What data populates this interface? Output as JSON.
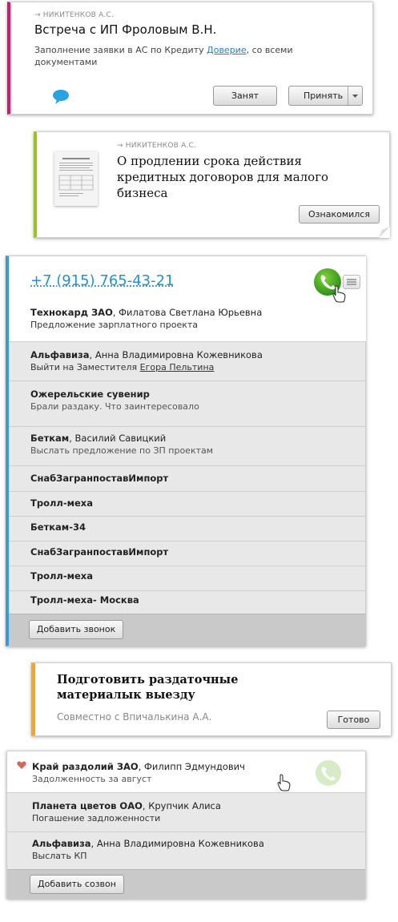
{
  "card1": {
    "from": "→ НИКИТЕНКОВ А.С.",
    "title": "Встреча с ИП Фроловым В.Н.",
    "desc_before": "Заполнение заявки в АС по Кредиту ",
    "desc_link": "Доверие",
    "desc_after": ", со всеми документами",
    "btn_busy": "Занят",
    "btn_accept": "Принять",
    "accent": "#d8166b"
  },
  "card2": {
    "from": "→ НИКИТЕНКОВ А.С.",
    "title_lines": [
      "О продлении срока действия",
      "кредитных договоров для малого",
      "бизнеса"
    ],
    "btn": "Ознакомился",
    "accent": "#9bc31d"
  },
  "card3": {
    "phone": "+7 (915) 765-43-21",
    "accent": "#3a9ad9",
    "active": {
      "company": "Технокард ЗАО",
      "person": ", Филатова Светлана Юрьевна",
      "note": "Предложение зарплатного проекта"
    },
    "rows": [
      {
        "company": "Альфавиза",
        "person": ", Анна Владимировна Кожевникова",
        "note_before": "Выйти на Заместителя ",
        "note_link": "Егора Пельтина"
      },
      {
        "company": "Ожерельские сувенир",
        "person": "",
        "note_before": "Брали раздаку. Что заинтересовало",
        "note_link": ""
      },
      {
        "company": "Беткам",
        "person": ", Василий Савицкий",
        "note_before": "Выслать предложение по ЗП проектам",
        "note_link": ""
      },
      {
        "company": "СнабЗагранпоставИмпорт",
        "person": "",
        "note_before": "",
        "note_link": ""
      },
      {
        "company": "Тролл-меха",
        "person": "",
        "note_before": "",
        "note_link": ""
      },
      {
        "company": "Беткам-34",
        "person": "",
        "note_before": "",
        "note_link": ""
      },
      {
        "company": "СнабЗагранпоставИмпорт",
        "person": "",
        "note_before": "",
        "note_link": ""
      },
      {
        "company": "Тролл-меха",
        "person": "",
        "note_before": "",
        "note_link": ""
      },
      {
        "company": "Тролл-меха- Москва",
        "person": "",
        "note_before": "",
        "note_link": ""
      }
    ],
    "btn": "Добавить звонок"
  },
  "card4": {
    "title_lines": [
      "Подготовить раздаточные",
      "материалык выезду"
    ],
    "sub": "Совместно с Впичалькина А.А.",
    "btn": "Готово",
    "accent": "#f5a623"
  },
  "card5": {
    "rows": [
      {
        "company": "Край раздолий ЗАО",
        "person": ", Филипп Эдмундович",
        "note": "Задолженность за август"
      },
      {
        "company": "Планета цветов ОАО",
        "person": ", Крупчик Алиса",
        "note": "Погашение задложенности"
      },
      {
        "company": "Альфавиза",
        "person": ", Анна Владимировна Кожевникова",
        "note": "Выслать КП"
      }
    ],
    "btn": "Добавить созвон"
  }
}
